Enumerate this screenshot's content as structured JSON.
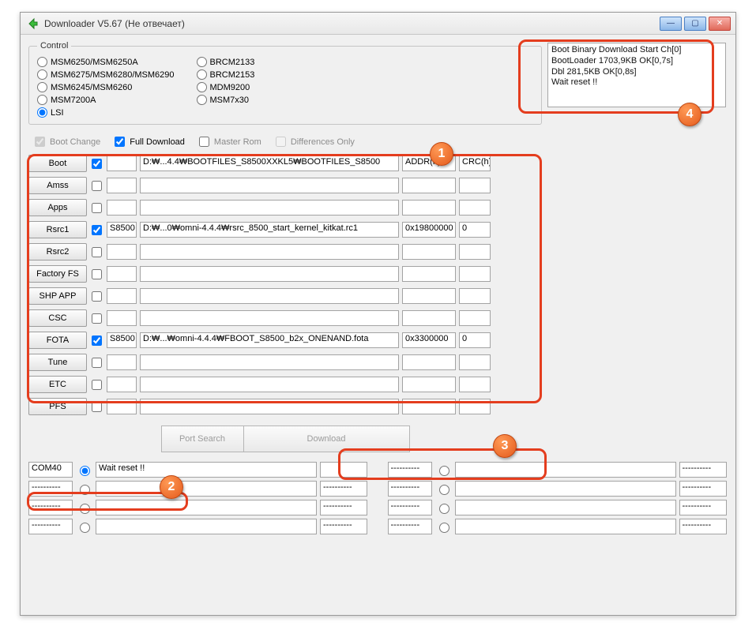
{
  "window": {
    "title": "Downloader V5.67  (Не отвечает)"
  },
  "control": {
    "legend": "Control",
    "col1": [
      {
        "label": "MSM6250/MSM6250A",
        "checked": false
      },
      {
        "label": "MSM6275/MSM6280/MSM6290",
        "checked": false
      },
      {
        "label": "MSM6245/MSM6260",
        "checked": false
      },
      {
        "label": "MSM7200A",
        "checked": false
      },
      {
        "label": "LSI",
        "checked": true
      }
    ],
    "col2": [
      {
        "label": "BRCM2133",
        "checked": false
      },
      {
        "label": "BRCM2153",
        "checked": false
      },
      {
        "label": "MDM9200",
        "checked": false
      },
      {
        "label": "MSM7x30",
        "checked": false
      }
    ]
  },
  "flags": {
    "boot_change": "Boot Change",
    "full_download": "Full Download",
    "master_rom": "Master Rom",
    "differences_only": "Differences Only"
  },
  "headers": {
    "addr": "ADDR(h)",
    "crc": "CRC(h)"
  },
  "rows": [
    {
      "name": "Boot",
      "chk": true,
      "a": "",
      "b": "D:₩...4.4₩BOOTFILES_S8500XXKL5₩BOOTFILES_S8500",
      "c": "ADDR(h)",
      "d": "CRC(h)"
    },
    {
      "name": "Amss",
      "chk": false,
      "a": "",
      "b": "",
      "c": "",
      "d": ""
    },
    {
      "name": "Apps",
      "chk": false,
      "a": "",
      "b": "",
      "c": "",
      "d": ""
    },
    {
      "name": "Rsrc1",
      "chk": true,
      "a": "S8500",
      "b": "D:₩...0₩omni-4.4.4₩rsrc_8500_start_kernel_kitkat.rc1",
      "c": "0x19800000",
      "d": "0"
    },
    {
      "name": "Rsrc2",
      "chk": false,
      "a": "",
      "b": "",
      "c": "",
      "d": ""
    },
    {
      "name": "Factory FS",
      "chk": false,
      "a": "",
      "b": "",
      "c": "",
      "d": ""
    },
    {
      "name": "SHP APP",
      "chk": false,
      "a": "",
      "b": "",
      "c": "",
      "d": ""
    },
    {
      "name": "CSC",
      "chk": false,
      "a": "",
      "b": "",
      "c": "",
      "d": ""
    },
    {
      "name": "FOTA",
      "chk": true,
      "a": "S8500",
      "b": "D:₩...₩omni-4.4.4₩FBOOT_S8500_b2x_ONENAND.fota",
      "c": "0x3300000",
      "d": "0"
    },
    {
      "name": "Tune",
      "chk": false,
      "a": "",
      "b": "",
      "c": "",
      "d": ""
    },
    {
      "name": "ETC",
      "chk": false,
      "a": "",
      "b": "",
      "c": "",
      "d": ""
    },
    {
      "name": "PFS",
      "chk": false,
      "a": "",
      "b": "",
      "c": "",
      "d": ""
    }
  ],
  "actions": {
    "port_search": "Port Search",
    "download": "Download"
  },
  "ports": {
    "dash": "----------",
    "row0": {
      "p1": "COM40",
      "status": "Wait reset !!"
    }
  },
  "log": {
    "l1": "Boot Binary Download Start Ch[0]",
    "l2": "BootLoader 1703,9KB OK[0,7s]",
    "l3": "Dbl 281,5KB OK[0,8s]",
    "l4": "Wait reset !!"
  },
  "callouts": {
    "c1": "1",
    "c2": "2",
    "c3": "3",
    "c4": "4"
  }
}
